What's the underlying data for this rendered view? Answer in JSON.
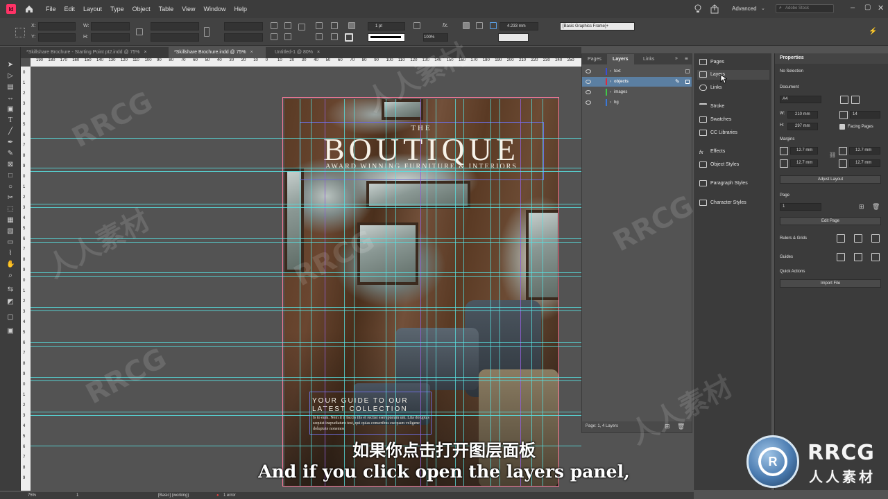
{
  "app": {
    "badge": "Id",
    "menu": [
      "File",
      "Edit",
      "Layout",
      "Type",
      "Object",
      "Table",
      "View",
      "Window",
      "Help"
    ],
    "workspace": "Advanced",
    "search_placeholder": "Adobe Stock"
  },
  "controlbar": {
    "x_label": "X:",
    "y_label": "Y:",
    "w_label": "W:",
    "h_label": "H:",
    "stroke_weight": "1 pt",
    "zoom_percent": "100%",
    "offset_value": "4.233 mm",
    "frame_style": "[Basic Graphics Frame]+"
  },
  "tabs": [
    {
      "label": "*Skillshare Brochure - Starting Point pt2.indd @ 75%",
      "close": "×",
      "active": false
    },
    {
      "label": "*Skillshare Brochure.indd @ 75%",
      "close": "×",
      "active": true
    },
    {
      "label": "Untitled-1 @ 80%",
      "close": "×",
      "active": false
    }
  ],
  "ruler": {
    "h_ticks": [
      "190",
      "180",
      "170",
      "160",
      "150",
      "140",
      "130",
      "120",
      "110",
      "100",
      "90",
      "80",
      "70",
      "60",
      "50",
      "40",
      "30",
      "20",
      "10",
      "0",
      "10",
      "20",
      "30",
      "40",
      "50",
      "60",
      "70",
      "80",
      "90",
      "100",
      "110",
      "120",
      "130",
      "140",
      "150",
      "160",
      "170",
      "180",
      "190",
      "200",
      "210",
      "220",
      "230",
      "240",
      "250"
    ],
    "v_ticks": [
      "0",
      "1",
      "2",
      "3",
      "4",
      "5",
      "6",
      "7",
      "8",
      "9",
      "0",
      "1",
      "2",
      "3",
      "4",
      "5",
      "6",
      "7",
      "8",
      "9",
      "0",
      "1",
      "2",
      "3",
      "4",
      "5",
      "6",
      "7",
      "8",
      "9",
      "0",
      "1",
      "2",
      "3",
      "4",
      "5",
      "6",
      "7",
      "8",
      "9"
    ]
  },
  "cover": {
    "the": "THE",
    "title": "BOUTIQUE",
    "subtitle": "AWARD WINNING FURNITURE & INTERIORS",
    "guide_line1": "YOUR GUIDE TO OUR",
    "guide_line2": "LATEST COLLECTION",
    "body": "Is to eum. Nem il il faccis ilis et rectiat eseruptatum unt. Lita doluptas sequist inspudiatum test, qui quias conseribus esequam veligene doluptate nonemos"
  },
  "layers_panel": {
    "tabs": [
      "Pages",
      "Layers",
      "Links"
    ],
    "active_tab": "Layers",
    "layers": [
      {
        "name": "text",
        "color": "#3a4fd8",
        "selected": false
      },
      {
        "name": "objects",
        "color": "#e0283c",
        "selected": true
      },
      {
        "name": "images",
        "color": "#40c848",
        "selected": false
      },
      {
        "name": "bg",
        "color": "#3a78d8",
        "selected": false
      }
    ],
    "footer": "Page: 1, 4 Layers"
  },
  "dock": {
    "items": [
      "Pages",
      "Layers",
      "Links",
      "Stroke",
      "Swatches",
      "CC Libraries",
      "Effects",
      "Object Styles",
      "Paragraph Styles",
      "Character Styles"
    ],
    "active": "Layers"
  },
  "properties": {
    "title": "Properties",
    "selection": "No Selection",
    "document_h": "Document",
    "size_preset": "A4",
    "width": "210 mm",
    "height": "297 mm",
    "pages_count": "14",
    "facing_pages": "Facing Pages",
    "margins_h": "Margins",
    "margin_top": "12.7 mm",
    "margin_bottom": "12.7 mm",
    "margin_left": "12.7 mm",
    "margin_right": "12.7 mm",
    "adjust_layout": "Adjust Layout",
    "page_h": "Page",
    "page_value": "1",
    "edit_page": "Edit Page",
    "rulers_grids": "Rulers & Grids",
    "guides": "Guides",
    "quick_actions": "Quick Actions",
    "import_file": "Import File"
  },
  "subtitles": {
    "cn": "如果你点击打开图层面板",
    "en": "And if you click open the layers panel,"
  },
  "statusbar": {
    "zoom": "75%",
    "page": "1",
    "profile": "[Basic] (working)",
    "errors": "1 error"
  },
  "watermark": {
    "text": "RRCG",
    "cn_text": "人人素材",
    "logo_text": "RRCG",
    "logo_cn": "人人素材"
  }
}
